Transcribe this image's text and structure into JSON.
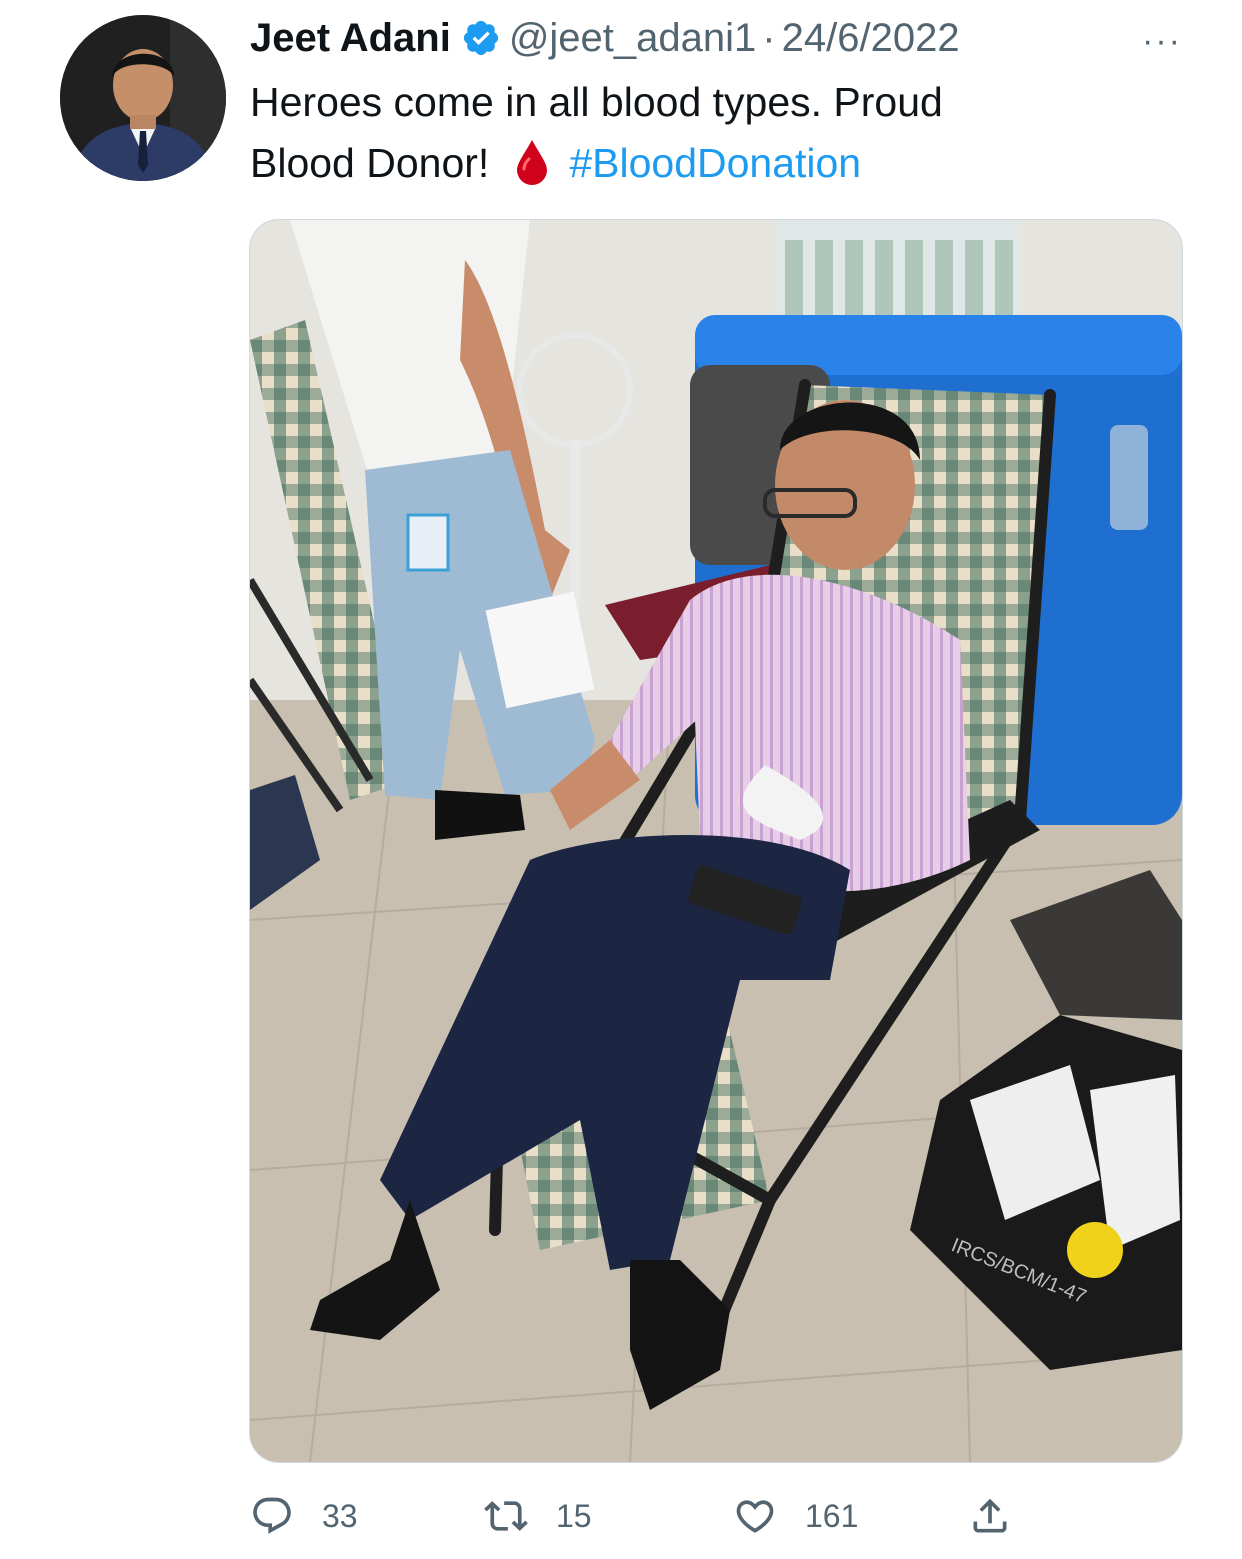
{
  "tweet": {
    "display_name": "Jeet Adani",
    "handle": "@jeet_adani1",
    "separator": "·",
    "date": "24/6/2022",
    "more_label": "···",
    "text_line1": "Heroes come in all blood types. Proud",
    "text_line2": "Blood Donor!",
    "hashtag": "#BloodDonation"
  },
  "media": {
    "alt_description": "",
    "box_label": "IRCS/BCM/1-47"
  },
  "actions": {
    "replies": "33",
    "retweets": "15",
    "likes": "161"
  },
  "icons": {
    "verified": "verified-badge-icon",
    "drop": "blood-drop-emoji",
    "reply": "reply-icon",
    "retweet": "retweet-icon",
    "like": "heart-icon",
    "share": "share-icon"
  },
  "colors": {
    "accent": "#1d9bf0",
    "text": "#0f1419",
    "muted": "#536471",
    "drop": "#d0021b"
  }
}
